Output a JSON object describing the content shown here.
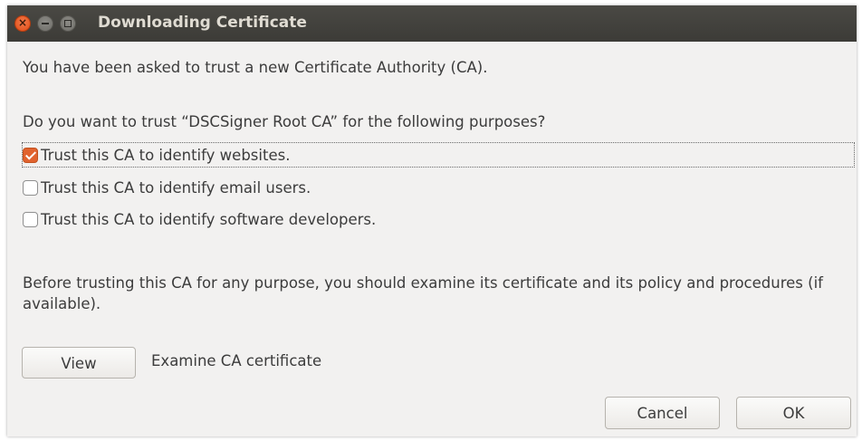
{
  "window": {
    "title": "Downloading Certificate",
    "close_glyph": "×"
  },
  "dialog": {
    "intro": "You have been asked to trust a new Certificate Authority (CA).",
    "question": "Do you want to trust “DSCSigner Root CA” for the following purposes?",
    "options": [
      {
        "label": "Trust this CA to identify websites.",
        "checked": true
      },
      {
        "label": "Trust this CA to identify email users.",
        "checked": false
      },
      {
        "label": "Trust this CA to identify software developers.",
        "checked": false
      }
    ],
    "advice": "Before trusting this CA for any purpose, you should examine its certificate and its policy and procedures (if available).",
    "view_button": "View",
    "view_description": "Examine CA certificate",
    "cancel_button": "Cancel",
    "ok_button": "OK"
  },
  "colors": {
    "titlebar": "#3c3b37",
    "accent": "#e1632f",
    "background": "#f2f1f0"
  },
  "icons": {
    "close": "close-icon",
    "minimize": "minimize-icon",
    "maximize": "maximize-icon",
    "checkbox_checked": "checkbox-checked-icon"
  }
}
